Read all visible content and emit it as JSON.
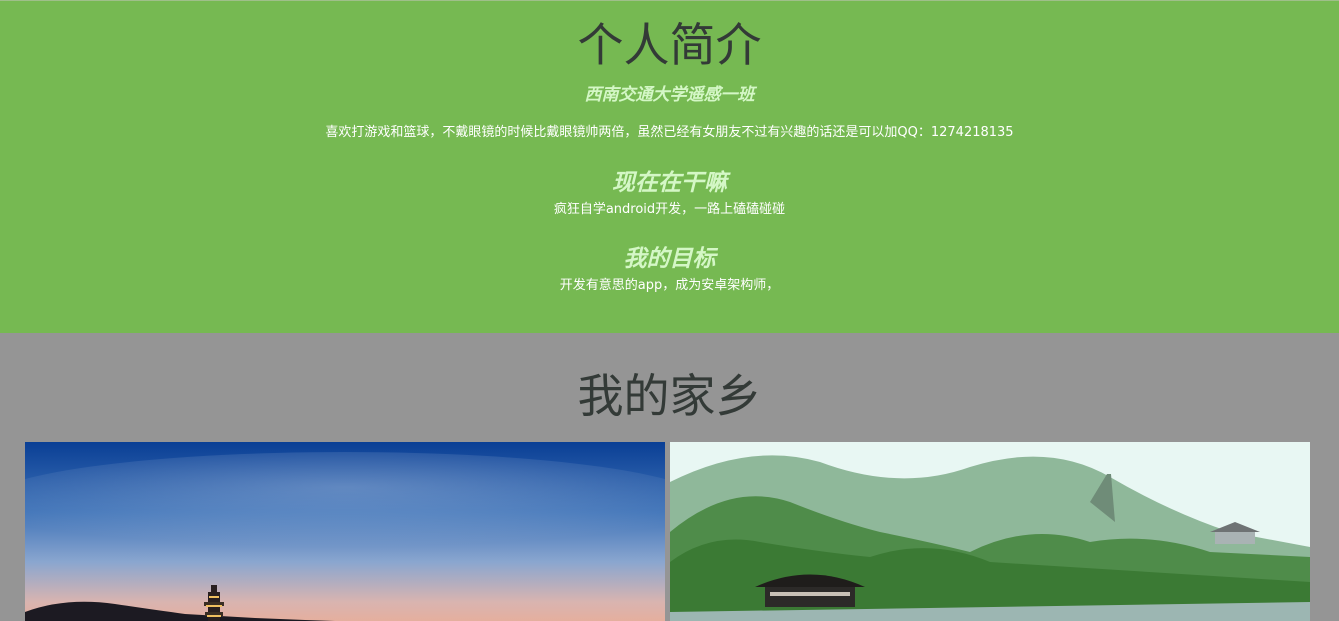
{
  "profile": {
    "title": "个人简介",
    "subtitle": "西南交通大学遥感一班",
    "bio": "喜欢打游戏和篮球，不戴眼镜的时候比戴眼镜帅两倍，虽然已经有女朋友不过有兴趣的话还是可以加QQ：1274218135",
    "now_heading": "现在在干嘛",
    "now_text": "疯狂自学android开发，一路上磕磕碰碰",
    "goal_heading": "我的目标",
    "goal_text": "开发有意思的app，成为安卓架构师，"
  },
  "hometown": {
    "title": "我的家乡",
    "photos": [
      "pagoda-dusk-photo",
      "lake-pavilion-photo"
    ]
  },
  "colors": {
    "profile_bg": "#76b952",
    "hometown_bg": "#959595",
    "heading_text": "#333a37",
    "accent_text": "#d4f7c6"
  }
}
